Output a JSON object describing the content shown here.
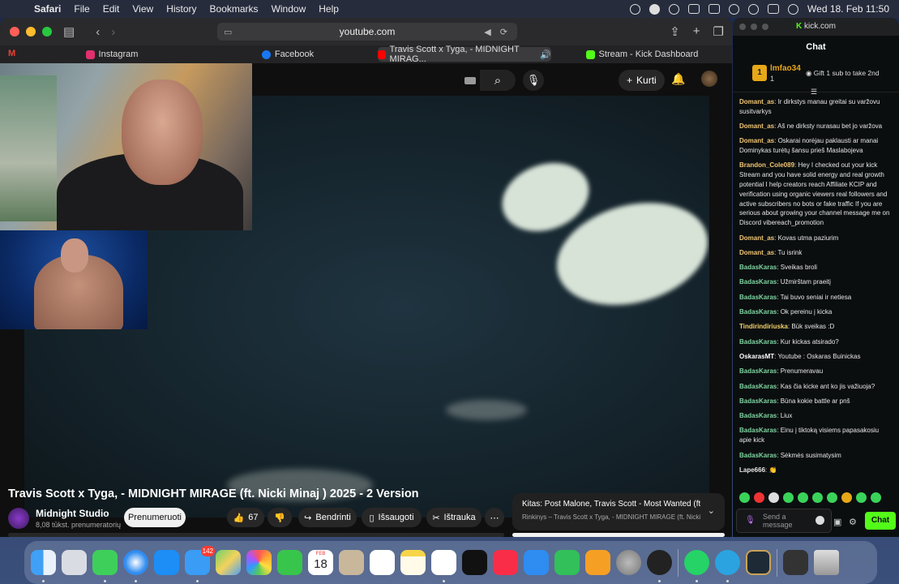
{
  "menubar": {
    "app": "Safari",
    "items": [
      "File",
      "Edit",
      "View",
      "History",
      "Bookmarks",
      "Window",
      "Help"
    ],
    "clock": "Wed 18. Feb  11:50"
  },
  "safari": {
    "url": "youtube.com",
    "tabs": [
      {
        "label": "Instagram",
        "color": "#e1306c"
      },
      {
        "label": "Facebook",
        "color": "#1877f2"
      },
      {
        "label": "Travis Scott x Tyga, - MIDNIGHT MIRAG...",
        "color": "#ff0000"
      },
      {
        "label": "Stream - Kick Dashboard",
        "color": "#53fc18"
      }
    ]
  },
  "youtube": {
    "create_label": "Kurti",
    "video_title": "Travis Scott x Tyga, - MIDNIGHT MIRAGE (ft. Nicki Minaj ) 2025 - 2 Version",
    "channel_name": "Midnight Studio",
    "channel_subs": "8,08 tūkst. prenumeratorių",
    "subscribe_label": "Prenumeruoti",
    "like_count": "67",
    "share_label": "Bendrinti",
    "save_label": "Išsaugoti",
    "clip_label": "Ištrauka",
    "up_next_title": "Kitas: Post Malone, Travis Scott - Most Wanted (ft. ...",
    "up_next_sub": "Rinkinys – Travis Scott x Tyga, - MIDNIGHT MIRAGE (ft. Nicki I"
  },
  "kick": {
    "url": "kick.com",
    "title": "Chat",
    "gift_user": "lmfao34",
    "gift_rank": "1",
    "gift_count": "1",
    "gift_text": "Gift 1 sub to take 2nd",
    "messages": [
      {
        "user": "Domant_as",
        "color": "#f0c674",
        "text": "Ir dirkstys manau greitai su varžovu susitvarkys"
      },
      {
        "user": "Domant_as",
        "color": "#f0c674",
        "text": "Aš ne dirksty nurasau bet jo varžova"
      },
      {
        "user": "Domant_as",
        "color": "#f0c674",
        "text": "Oskarai norėjau paklausti ar manai Dominykas turėtų šansu prieš Maslabojeva"
      },
      {
        "user": "Brandon_Cole089",
        "color": "#f0c674",
        "text": "Hey I checked out your kick Stream and you have solid energy and real growth potential I help creators reach Affiliate KCIP and verification using organic viewers real followers and active subscribers no bots or fake traffic If you are serious about growing your channel message me on Discord vibereach_promotion"
      },
      {
        "user": "Domant_as",
        "color": "#f0c674",
        "text": "Kovas utma paziurim"
      },
      {
        "user": "Domant_as",
        "color": "#f0c674",
        "text": "Tu isrink"
      },
      {
        "user": "BadasKaras",
        "color": "#7ed3a0",
        "text": "Sveikas broli"
      },
      {
        "user": "BadasKaras",
        "color": "#7ed3a0",
        "text": "Užmirštam praeitį"
      },
      {
        "user": "BadasKaras",
        "color": "#7ed3a0",
        "text": "Tai buvo seniai ir netiesa"
      },
      {
        "user": "BadasKaras",
        "color": "#7ed3a0",
        "text": "Ok pereinu į kicka"
      },
      {
        "user": "Tindirindiriuska",
        "color": "#f5d26b",
        "text": "Būk sveikas :D"
      },
      {
        "user": "BadasKaras",
        "color": "#7ed3a0",
        "text": "Kur kickas atsirado?"
      },
      {
        "user": "OskarasMT",
        "color": "#ffffff",
        "text": "Youtube : Oskaras Buinickas"
      },
      {
        "user": "BadasKaras",
        "color": "#7ed3a0",
        "text": "Prenumeravau"
      },
      {
        "user": "BadasKaras",
        "color": "#7ed3a0",
        "text": "Kas čia kicke ant ko jis važiuoja?"
      },
      {
        "user": "BadasKaras",
        "color": "#7ed3a0",
        "text": "Būna kokie battle ar pnš"
      },
      {
        "user": "BadasKaras",
        "color": "#7ed3a0",
        "text": "Liux"
      },
      {
        "user": "BadasKaras",
        "color": "#7ed3a0",
        "text": "Einu į tiktoką visiems papasakosiu apie kick"
      },
      {
        "user": "BadasKaras",
        "color": "#7ed3a0",
        "text": "Sėkmės susimatysim"
      },
      {
        "user": "Lape666",
        "color": "#e6e6e6",
        "text": "👏"
      }
    ],
    "send_placeholder": "Send a message",
    "chat_button": "Chat",
    "accent": "#53fc18"
  },
  "dock": {
    "mail_badge": "142",
    "calendar_day": "18",
    "calendar_month": "FEB"
  }
}
